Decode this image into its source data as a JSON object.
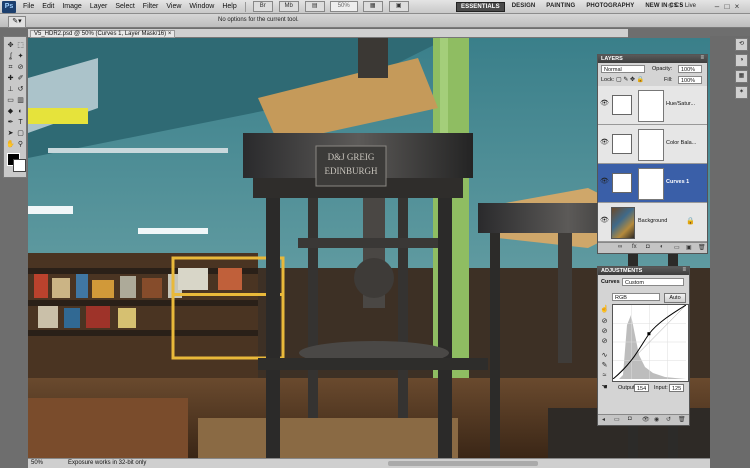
{
  "menu": {
    "app_logo": "Ps",
    "items": [
      "File",
      "Edit",
      "Image",
      "Layer",
      "Select",
      "Filter",
      "View",
      "Window",
      "Help"
    ],
    "zoom_value": "50%"
  },
  "workspaces": [
    "ESSENTIALS",
    "DESIGN",
    "PAINTING",
    "PHOTOGRAPHY",
    "NEW IN CS 5"
  ],
  "cs_live": "CS Live",
  "options_bar": {
    "message": "No options for the current tool."
  },
  "document": {
    "title": "V5_HDR2.psd @ 50% (Curves 1, Layer Mask/16)",
    "status_zoom": "50%",
    "status_info": "Exposure works in 32-bit only"
  },
  "layers_panel": {
    "tab": "LAYERS",
    "blend_mode": "Normal",
    "opacity_label": "Opacity:",
    "opacity_value": "100%",
    "lock_label": "Lock:",
    "fill_label": "Fill:",
    "fill_value": "100%",
    "layers": [
      {
        "name": "Hue/Satur..."
      },
      {
        "name": "Color Bala..."
      },
      {
        "name": "Curves 1",
        "active": true
      },
      {
        "name": "Background"
      }
    ]
  },
  "adjustments_panel": {
    "tab": "ADJUSTMENTS",
    "type_label": "Curves",
    "preset": "Custom",
    "channel": "RGB",
    "auto_label": "Auto",
    "output_label": "Output:",
    "output_value": "154",
    "input_label": "Input:",
    "input_value": "125"
  },
  "colors": {
    "accent": "#3a5fa8",
    "panel_bg": "#d4d4d4",
    "workspace_active": "#4a4a4a"
  }
}
